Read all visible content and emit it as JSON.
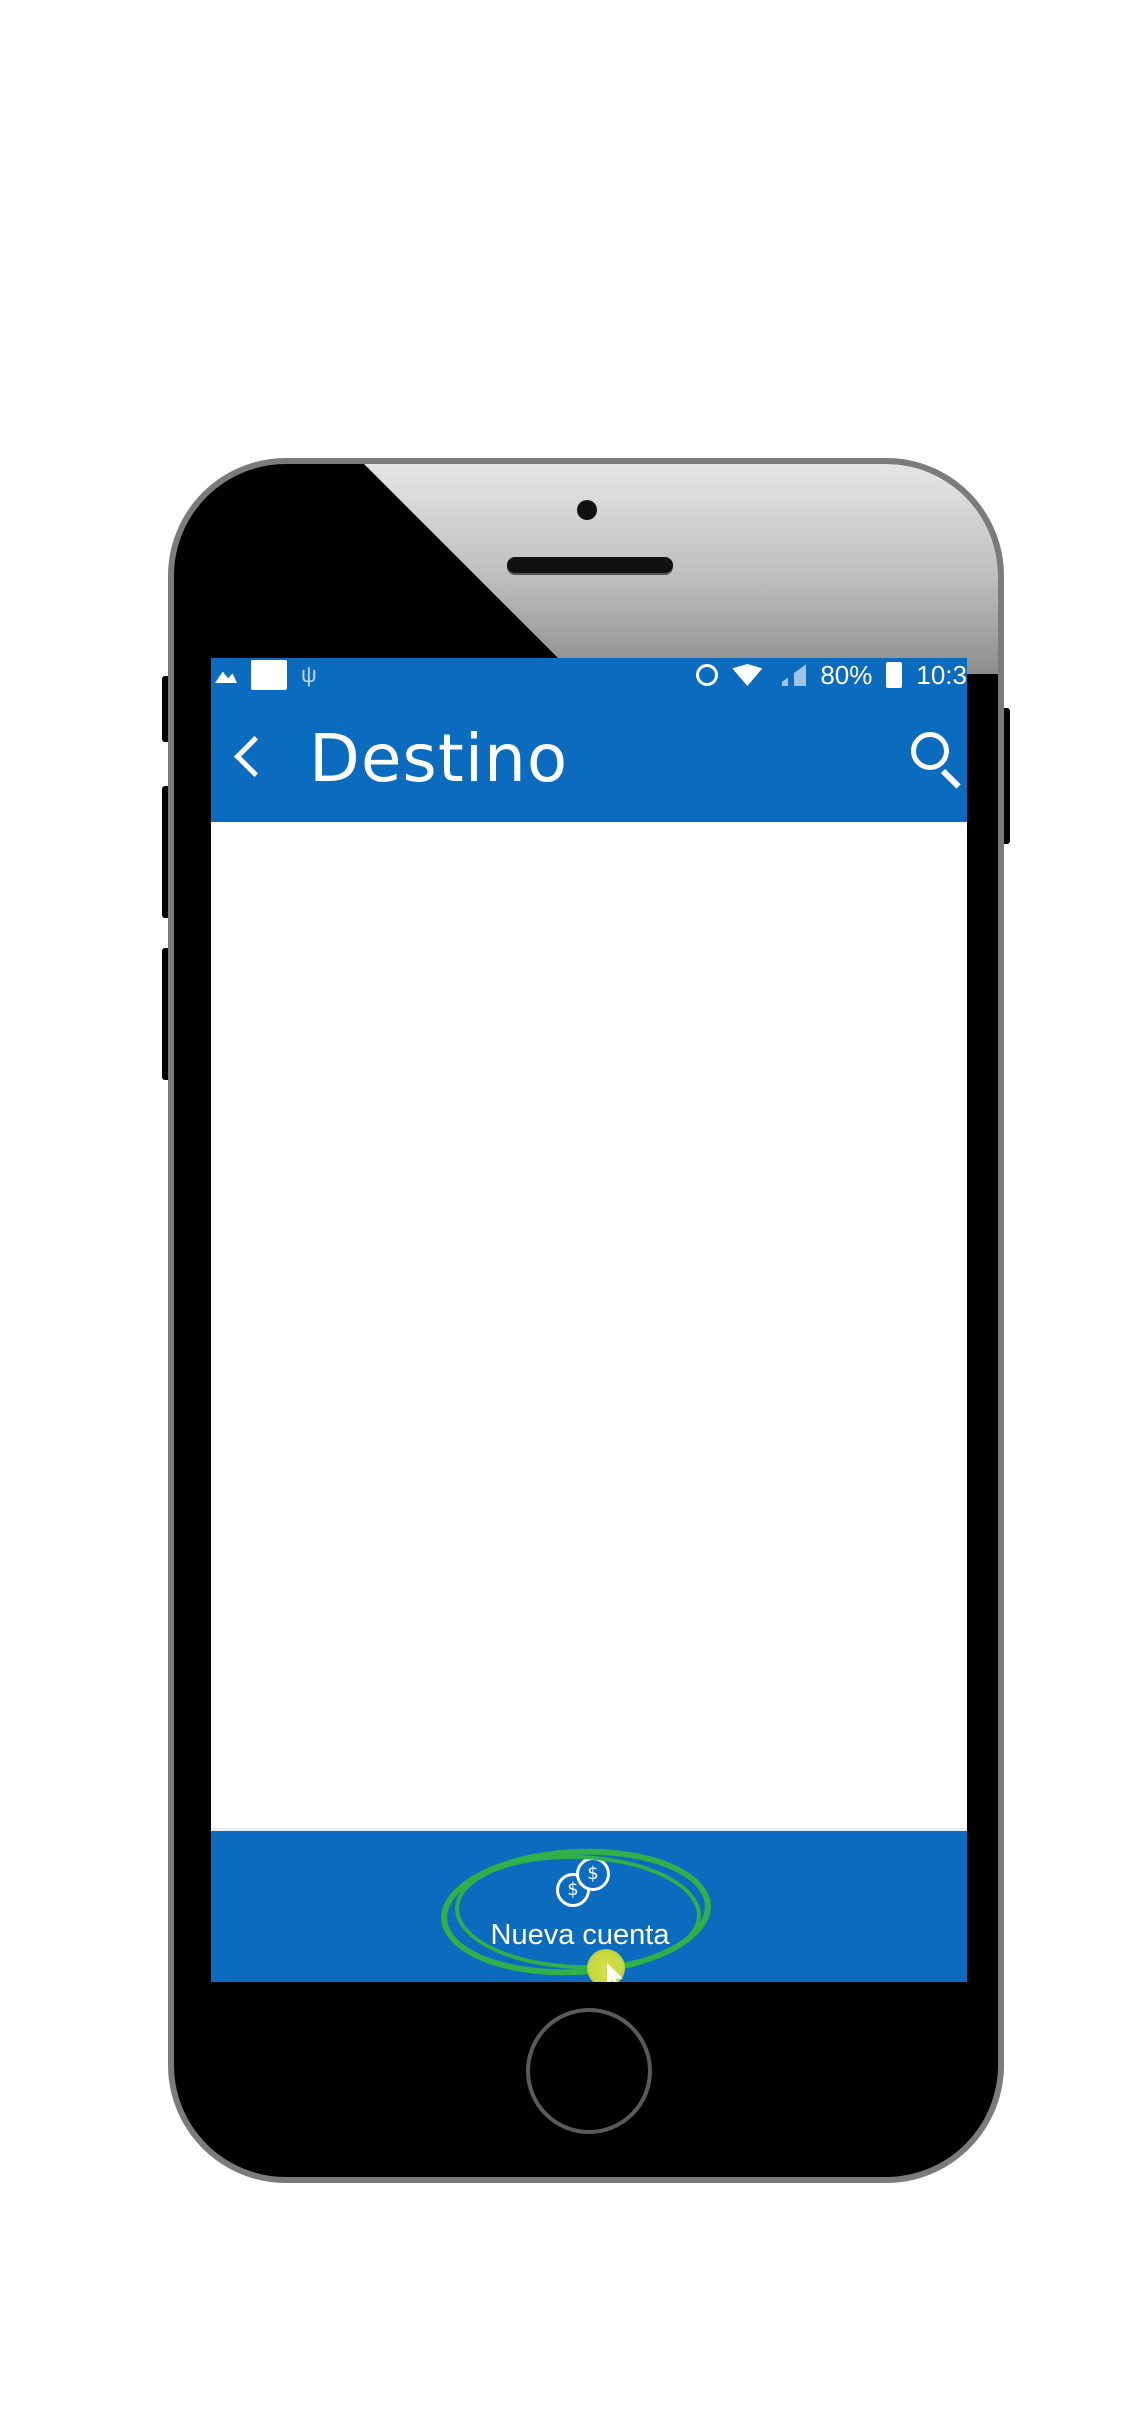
{
  "status_bar": {
    "battery_text": "80%",
    "time_text": "10:3"
  },
  "app_bar": {
    "title": "Destino",
    "back_icon": "chevron-left-icon",
    "search_icon": "search-icon"
  },
  "bottom_bar": {
    "new_account_label": "Nueva cuenta",
    "new_account_icon": "coins-icon",
    "coin_symbol": "$"
  },
  "colors": {
    "primary": "#0b6cbf",
    "highlight": "#2fb14a"
  }
}
